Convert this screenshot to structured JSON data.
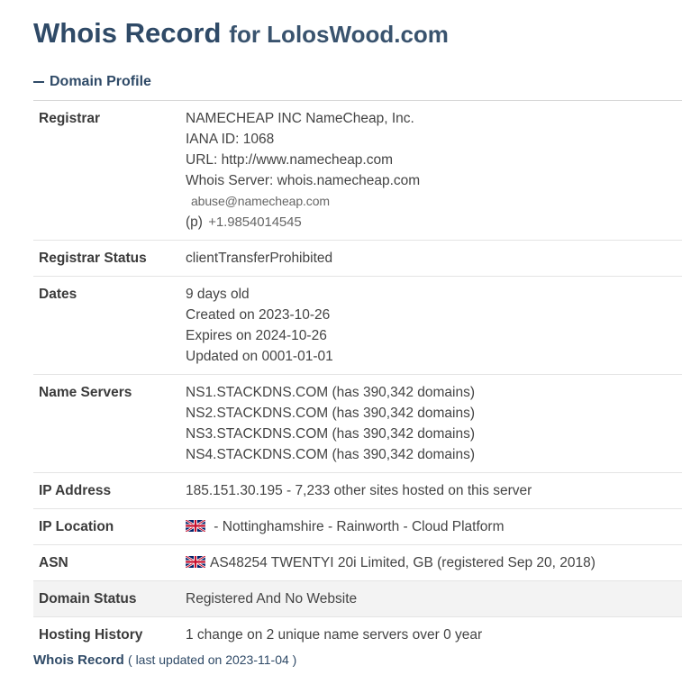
{
  "header": {
    "title_main": "Whois Record",
    "title_sub": "for LolosWood.com"
  },
  "section": {
    "label": "Domain Profile"
  },
  "rows": {
    "registrar": {
      "label": "Registrar",
      "lines": [
        "NAMECHEAP INC NameCheap, Inc.",
        "IANA ID: 1068",
        "URL: http://www.namecheap.com",
        "Whois Server: whois.namecheap.com"
      ],
      "email": "abuse@namecheap.com",
      "phone_prefix": "(p)",
      "phone": "+1.9854014545"
    },
    "registrar_status": {
      "label": "Registrar Status",
      "value": "clientTransferProhibited"
    },
    "dates": {
      "label": "Dates",
      "lines": [
        "9 days old",
        "Created on 2023-10-26",
        "Expires on 2024-10-26",
        "Updated on 0001-01-01"
      ]
    },
    "name_servers": {
      "label": "Name Servers",
      "lines": [
        "NS1.STACKDNS.COM (has 390,342 domains)",
        "NS2.STACKDNS.COM (has 390,342 domains)",
        "NS3.STACKDNS.COM (has 390,342 domains)",
        "NS4.STACKDNS.COM (has 390,342 domains)"
      ]
    },
    "ip_address": {
      "label": "IP Address",
      "value": "185.151.30.195 - 7,233 other sites hosted on this server"
    },
    "ip_location": {
      "label": "IP Location",
      "value": " - Nottinghamshire - Rainworth - Cloud Platform"
    },
    "asn": {
      "label": "ASN",
      "value": "AS48254 TWENTYI 20i Limited, GB (registered Sep 20, 2018)"
    },
    "domain_status": {
      "label": "Domain Status",
      "value": "Registered And No Website"
    },
    "hosting_history": {
      "label": "Hosting History",
      "value": "1 change on 2 unique name servers over 0 year"
    }
  },
  "footer": {
    "link": "Whois Record",
    "sub": "( last updated on 2023-11-04 )"
  },
  "icons": {
    "flag": "uk-flag-icon"
  }
}
